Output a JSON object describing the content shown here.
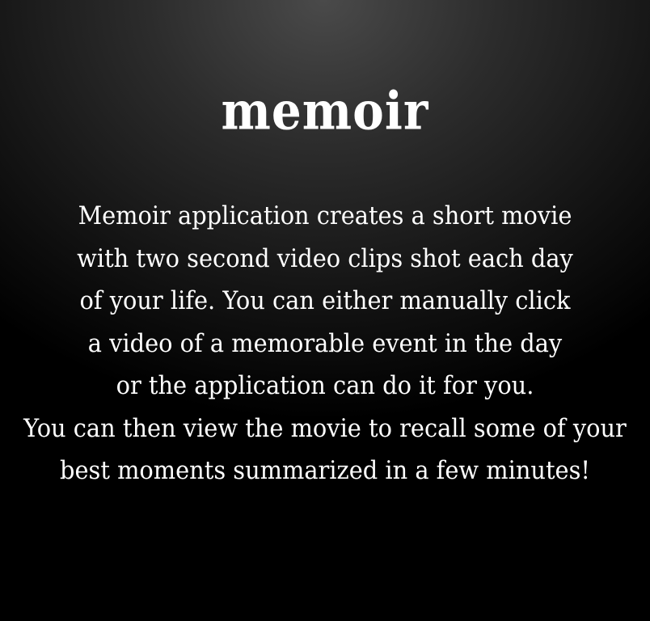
{
  "app": {
    "title": "memoir"
  },
  "description": {
    "lines": [
      "Memoir application creates a short movie",
      "with two second video clips shot each day",
      "of your life. You can either manually click",
      "a video of a memorable event in the day",
      "or the application can do it for you.",
      "You can then view the movie to recall some of your",
      "best moments summarized in a few minutes!"
    ]
  },
  "colors": {
    "background_center": "#4a4a4a",
    "background_edge": "#000000",
    "text": "#ffffff"
  }
}
